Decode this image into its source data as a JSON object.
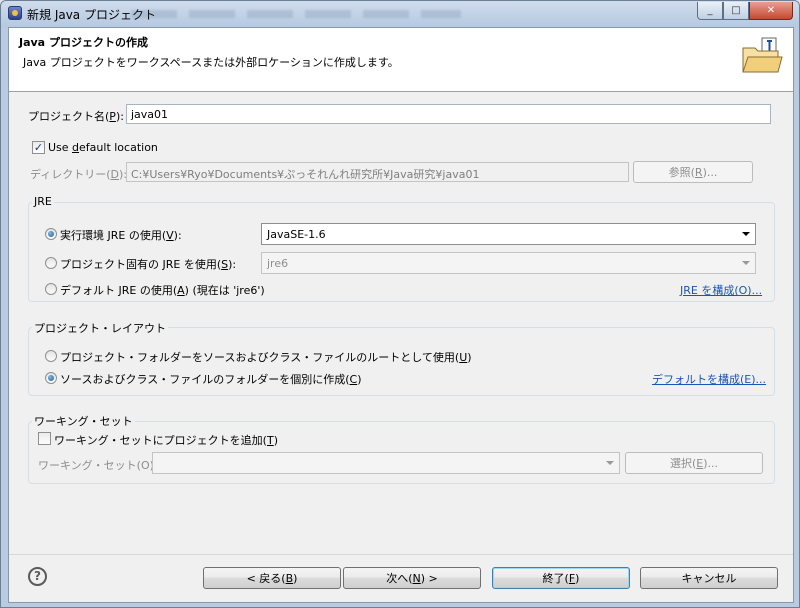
{
  "window": {
    "title": "新規 Java プロジェクト",
    "controls": {
      "minimize": "_",
      "maximize": "□",
      "close": "✕"
    }
  },
  "header": {
    "title": "Java プロジェクトの作成",
    "message": "Java プロジェクトをワークスペースまたは外部ロケーションに作成します。",
    "icon": "new-java-project-folder-icon"
  },
  "project": {
    "name_label_pre": "プロジェクト名(",
    "name_label_key": "P",
    "name_label_post": "):",
    "name_value": "java01"
  },
  "location": {
    "use_default_checked": true,
    "use_default_pre": "Use ",
    "use_default_key": "d",
    "use_default_post": "efault location",
    "dir_label_pre": "ディレクトリー(",
    "dir_label_key": "D",
    "dir_label_post": "):",
    "dir_value": "C:¥Users¥Ryo¥Documents¥ぷっそれんれ研究所¥Java研究¥java01",
    "browse_pre": "参照(",
    "browse_key": "R",
    "browse_post": ")..."
  },
  "jre": {
    "group_title": "JRE",
    "opt1_pre": "実行環境 JRE の使用(",
    "opt1_key": "V",
    "opt1_post": "):",
    "opt1_selected": true,
    "opt1_combo": "JavaSE-1.6",
    "opt2_pre": "プロジェクト固有の JRE を使用(",
    "opt2_key": "S",
    "opt2_post": "):",
    "opt2_combo": "jre6",
    "opt3_pre": "デフォルト JRE の使用(",
    "opt3_key": "A",
    "opt3_post": ") (現在は 'jre6')",
    "configure_link": "JRE を構成(O)..."
  },
  "layout": {
    "group_title": "プロジェクト・レイアウト",
    "opt1_pre": "プロジェクト・フォルダーをソースおよびクラス・ファイルのルートとして使用(",
    "opt1_key": "U",
    "opt1_post": ")",
    "opt2_pre": "ソースおよびクラス・ファイルのフォルダーを個別に作成(",
    "opt2_key": "C",
    "opt2_post": ")",
    "opt2_selected": true,
    "configure_link": "デフォルトを構成(E)..."
  },
  "working_set": {
    "group_title": "ワーキング・セット",
    "add_checked": false,
    "add_pre": "ワーキング・セットにプロジェクトを追加(",
    "add_key": "T",
    "add_post": ")",
    "sets_label": "ワーキング・セット(O):",
    "select_pre": "選択(",
    "select_key": "E",
    "select_post": ")..."
  },
  "footer": {
    "help_glyph": "?",
    "back_pre": "< 戻る(",
    "back_key": "B",
    "back_post": ")",
    "next_pre": "次へ(",
    "next_key": "N",
    "next_post": ") >",
    "finish_pre": "終了(",
    "finish_key": "F",
    "finish_post": ")",
    "cancel": "キャンセル"
  }
}
